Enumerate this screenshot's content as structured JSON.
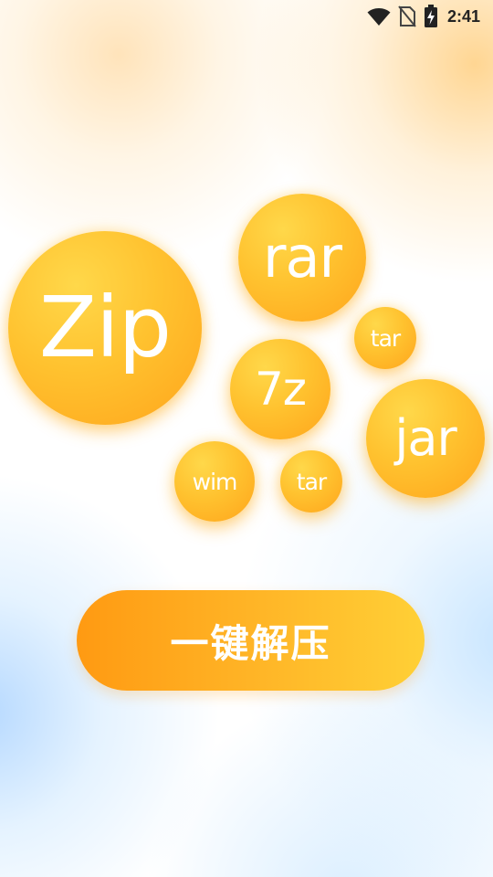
{
  "status_bar": {
    "time": "2:41",
    "icons": [
      "wifi-icon",
      "no-sim-icon",
      "battery-charging-icon"
    ]
  },
  "bubbles": {
    "zip": "Zip",
    "rar": "rar",
    "tar_top": "tar",
    "sevenz": "7z",
    "jar": "jar",
    "wim": "wim",
    "tar_bottom": "tar"
  },
  "actions": {
    "extract_label": "一键解压"
  },
  "colors": {
    "bubble_light": "#ffd84a",
    "bubble_dark": "#ffa51c",
    "button_left": "#ff9a12",
    "button_right": "#ffd036",
    "text": "#ffffff"
  }
}
